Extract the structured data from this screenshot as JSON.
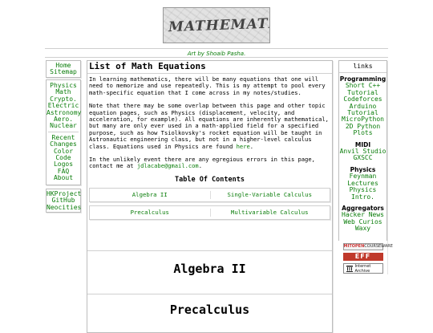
{
  "header": {
    "banner_text": "MATHEMATICS",
    "art_credit": "Art by Shoaib Pasha."
  },
  "left_nav": {
    "groups": [
      [
        "Home",
        "Sitemap"
      ],
      [
        "Physics",
        "Math",
        "Crypto.",
        "Electric",
        "Astronomy",
        "Aero.",
        "Nuclear"
      ],
      [
        "Recent",
        "Changes",
        "Color",
        "Code",
        "Logos",
        "FAQ",
        "About"
      ],
      [
        "HKProject",
        "GitHub",
        "Neocities"
      ]
    ]
  },
  "main": {
    "title": "List of Math Equations",
    "intro": "In learning mathematics, there will be many equations that one will need to memorize and use repeatedly. This is my attempt to pool every math-specific equation that I come across in my notes/studies.",
    "overlap_text": "Note that there may be some overlap between this page and other topic equation pages, such as Physics (displacement, velocity, and acceleration, for example). All equations are inherently mathematical, but many are only ever used in a math-applied field for a specified purpose, such as how Tsiolkovsky's rocket equation will be taught in Astronautic engineering class, but not in a higher-level calculus class. Equations used in Physics are found",
    "overlap_link": "here",
    "overlap_end": ".",
    "error_text": "In the unlikely event there are any egregious errors in this page, contact me at",
    "email": "jdlacabe@gmail.com",
    "error_end": ".",
    "toc_title": "Table Of Contents",
    "toc": [
      [
        "Algebra II",
        "Single-Variable Calculus"
      ],
      [
        "Precalculus",
        "Multivariable Calculus"
      ]
    ],
    "sections": [
      "Algebra II",
      "Precalculus"
    ]
  },
  "right_sidebar": {
    "title": "links",
    "groups": [
      {
        "heading": "Programming",
        "items": [
          "Short C++",
          "Tutorial",
          "Codeforces",
          "Arduino",
          "Tutorial",
          "MicroPython",
          "2D Python",
          "Plots"
        ]
      },
      {
        "heading": "MIDI",
        "items": [
          "Anvil Studio",
          "GXSCC"
        ]
      },
      {
        "heading": "Physics",
        "items": [
          "Feynman",
          "Lectures",
          "Physics",
          "Intro."
        ]
      },
      {
        "heading": "Aggregators",
        "items": [
          "Hacker News",
          "Web Curios",
          "Waxy"
        ]
      }
    ],
    "badges": {
      "ocw_left": "MIT",
      "ocw_mid": "OPEN",
      "ocw_right": "COURSEWARE",
      "eff": "EFF",
      "ia_line1": "Internet",
      "ia_line2": "Archive"
    }
  },
  "colors": {
    "link": "#0a7d0a",
    "border": "#bdbdbd",
    "eff_red": "#c0392b"
  }
}
